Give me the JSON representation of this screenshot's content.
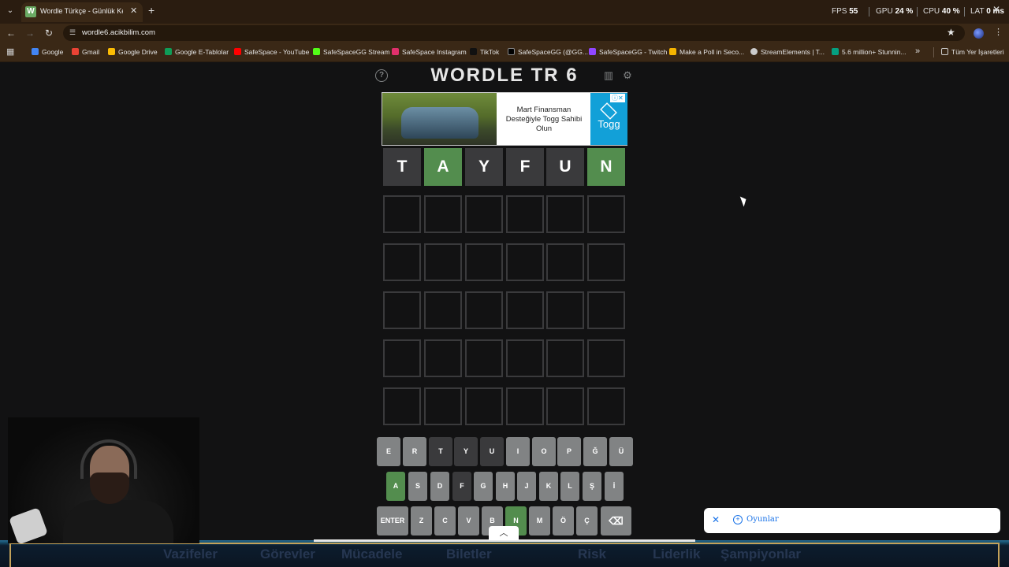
{
  "browser": {
    "tab_title": "Wordle Türkçe - Günlük Kelime",
    "url": "wordle6.acikbilim.com",
    "perf": {
      "fps_label": "FPS",
      "fps_value": "55",
      "gpu_label": "GPU",
      "gpu_value": "24 %",
      "cpu_label": "CPU",
      "cpu_value": "40 %",
      "lat_label": "LAT",
      "lat_value": "0 ms"
    },
    "bookmarks": [
      {
        "label": "Google",
        "icon": "google-icon",
        "color": "#4285f4"
      },
      {
        "label": "Gmail",
        "icon": "gmail-icon",
        "color": "#ea4335"
      },
      {
        "label": "Google Drive",
        "icon": "drive-icon",
        "color": "#fbbc04"
      },
      {
        "label": "Google E-Tablolar",
        "icon": "sheets-icon",
        "color": "#0f9d58"
      },
      {
        "label": "SafeSpace - YouTube",
        "icon": "youtube-icon",
        "color": "#ff0000"
      },
      {
        "label": "SafeSpaceGG Stream",
        "icon": "kick-icon",
        "color": "#53fc18"
      },
      {
        "label": "SafeSpace Instagram",
        "icon": "instagram-icon",
        "color": "#e1306c"
      },
      {
        "label": "TikTok",
        "icon": "tiktok-icon",
        "color": "#111111"
      },
      {
        "label": "SafeSpaceGG (@GG...",
        "icon": "x-icon",
        "color": "#000000"
      },
      {
        "label": "SafeSpaceGG - Twitch",
        "icon": "twitch-icon",
        "color": "#9146ff"
      },
      {
        "label": "Make a Poll in Seco...",
        "icon": "poll-icon",
        "color": "#f5b400"
      },
      {
        "label": "StreamElements | T...",
        "icon": "streamelements-icon",
        "color": "#cccccc"
      },
      {
        "label": "5.6 million+ Stunnin...",
        "icon": "pexels-icon",
        "color": "#05a081"
      }
    ],
    "all_bookmarks_label": "Tüm Yer İşaretleri"
  },
  "game": {
    "title": "WORDLE TR 6",
    "ad": {
      "text": "Mart Finansman Desteğiyle Togg Sahibi Olun",
      "brand": "Togg"
    },
    "board": [
      [
        {
          "l": "T",
          "s": "absent"
        },
        {
          "l": "A",
          "s": "correct"
        },
        {
          "l": "Y",
          "s": "absent"
        },
        {
          "l": "F",
          "s": "absent"
        },
        {
          "l": "U",
          "s": "absent"
        },
        {
          "l": "N",
          "s": "correct"
        }
      ],
      [
        {
          "l": "",
          "s": "empty"
        },
        {
          "l": "",
          "s": "empty"
        },
        {
          "l": "",
          "s": "empty"
        },
        {
          "l": "",
          "s": "empty"
        },
        {
          "l": "",
          "s": "empty"
        },
        {
          "l": "",
          "s": "empty"
        }
      ],
      [
        {
          "l": "",
          "s": "empty"
        },
        {
          "l": "",
          "s": "empty"
        },
        {
          "l": "",
          "s": "empty"
        },
        {
          "l": "",
          "s": "empty"
        },
        {
          "l": "",
          "s": "empty"
        },
        {
          "l": "",
          "s": "empty"
        }
      ],
      [
        {
          "l": "",
          "s": "empty"
        },
        {
          "l": "",
          "s": "empty"
        },
        {
          "l": "",
          "s": "empty"
        },
        {
          "l": "",
          "s": "empty"
        },
        {
          "l": "",
          "s": "empty"
        },
        {
          "l": "",
          "s": "empty"
        }
      ],
      [
        {
          "l": "",
          "s": "empty"
        },
        {
          "l": "",
          "s": "empty"
        },
        {
          "l": "",
          "s": "empty"
        },
        {
          "l": "",
          "s": "empty"
        },
        {
          "l": "",
          "s": "empty"
        },
        {
          "l": "",
          "s": "empty"
        }
      ],
      [
        {
          "l": "",
          "s": "empty"
        },
        {
          "l": "",
          "s": "empty"
        },
        {
          "l": "",
          "s": "empty"
        },
        {
          "l": "",
          "s": "empty"
        },
        {
          "l": "",
          "s": "empty"
        },
        {
          "l": "",
          "s": "empty"
        }
      ]
    ],
    "keyboard": [
      [
        {
          "k": "E",
          "s": "unused"
        },
        {
          "k": "R",
          "s": "unused"
        },
        {
          "k": "T",
          "s": "absent"
        },
        {
          "k": "Y",
          "s": "absent"
        },
        {
          "k": "U",
          "s": "absent"
        },
        {
          "k": "I",
          "s": "unused"
        },
        {
          "k": "O",
          "s": "unused"
        },
        {
          "k": "P",
          "s": "unused"
        },
        {
          "k": "Ğ",
          "s": "unused"
        },
        {
          "k": "Ü",
          "s": "unused"
        }
      ],
      [
        {
          "k": "A",
          "s": "correct"
        },
        {
          "k": "S",
          "s": "unused"
        },
        {
          "k": "D",
          "s": "unused"
        },
        {
          "k": "F",
          "s": "absent"
        },
        {
          "k": "G",
          "s": "unused"
        },
        {
          "k": "H",
          "s": "unused"
        },
        {
          "k": "J",
          "s": "unused"
        },
        {
          "k": "K",
          "s": "unused"
        },
        {
          "k": "L",
          "s": "unused"
        },
        {
          "k": "Ş",
          "s": "unused"
        },
        {
          "k": "İ",
          "s": "unused"
        }
      ],
      [
        {
          "k": "ENTER",
          "s": "unused"
        },
        {
          "k": "Z",
          "s": "unused"
        },
        {
          "k": "C",
          "s": "unused"
        },
        {
          "k": "V",
          "s": "unused"
        },
        {
          "k": "B",
          "s": "unused"
        },
        {
          "k": "N",
          "s": "correct"
        },
        {
          "k": "M",
          "s": "unused"
        },
        {
          "k": "Ö",
          "s": "unused"
        },
        {
          "k": "Ç",
          "s": "unused"
        },
        {
          "k": "⌫",
          "s": "unused"
        }
      ]
    ]
  },
  "toast": {
    "label": "Oyunlar"
  },
  "background_nav": [
    "Vazifeler",
    "Görevler",
    "Mücadele",
    "Biletler",
    "Risk",
    "Liderlik",
    "Şampiyonlar"
  ]
}
